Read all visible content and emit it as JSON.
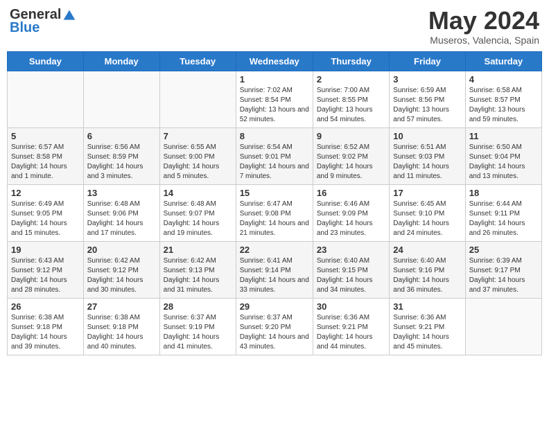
{
  "header": {
    "logo_general": "General",
    "logo_blue": "Blue",
    "month_title": "May 2024",
    "location": "Museros, Valencia, Spain"
  },
  "weekdays": [
    "Sunday",
    "Monday",
    "Tuesday",
    "Wednesday",
    "Thursday",
    "Friday",
    "Saturday"
  ],
  "weeks": [
    [
      {
        "day": "",
        "info": ""
      },
      {
        "day": "",
        "info": ""
      },
      {
        "day": "",
        "info": ""
      },
      {
        "day": "1",
        "info": "Sunrise: 7:02 AM\nSunset: 8:54 PM\nDaylight: 13 hours and 52 minutes."
      },
      {
        "day": "2",
        "info": "Sunrise: 7:00 AM\nSunset: 8:55 PM\nDaylight: 13 hours and 54 minutes."
      },
      {
        "day": "3",
        "info": "Sunrise: 6:59 AM\nSunset: 8:56 PM\nDaylight: 13 hours and 57 minutes."
      },
      {
        "day": "4",
        "info": "Sunrise: 6:58 AM\nSunset: 8:57 PM\nDaylight: 13 hours and 59 minutes."
      }
    ],
    [
      {
        "day": "5",
        "info": "Sunrise: 6:57 AM\nSunset: 8:58 PM\nDaylight: 14 hours and 1 minute."
      },
      {
        "day": "6",
        "info": "Sunrise: 6:56 AM\nSunset: 8:59 PM\nDaylight: 14 hours and 3 minutes."
      },
      {
        "day": "7",
        "info": "Sunrise: 6:55 AM\nSunset: 9:00 PM\nDaylight: 14 hours and 5 minutes."
      },
      {
        "day": "8",
        "info": "Sunrise: 6:54 AM\nSunset: 9:01 PM\nDaylight: 14 hours and 7 minutes."
      },
      {
        "day": "9",
        "info": "Sunrise: 6:52 AM\nSunset: 9:02 PM\nDaylight: 14 hours and 9 minutes."
      },
      {
        "day": "10",
        "info": "Sunrise: 6:51 AM\nSunset: 9:03 PM\nDaylight: 14 hours and 11 minutes."
      },
      {
        "day": "11",
        "info": "Sunrise: 6:50 AM\nSunset: 9:04 PM\nDaylight: 14 hours and 13 minutes."
      }
    ],
    [
      {
        "day": "12",
        "info": "Sunrise: 6:49 AM\nSunset: 9:05 PM\nDaylight: 14 hours and 15 minutes."
      },
      {
        "day": "13",
        "info": "Sunrise: 6:48 AM\nSunset: 9:06 PM\nDaylight: 14 hours and 17 minutes."
      },
      {
        "day": "14",
        "info": "Sunrise: 6:48 AM\nSunset: 9:07 PM\nDaylight: 14 hours and 19 minutes."
      },
      {
        "day": "15",
        "info": "Sunrise: 6:47 AM\nSunset: 9:08 PM\nDaylight: 14 hours and 21 minutes."
      },
      {
        "day": "16",
        "info": "Sunrise: 6:46 AM\nSunset: 9:09 PM\nDaylight: 14 hours and 23 minutes."
      },
      {
        "day": "17",
        "info": "Sunrise: 6:45 AM\nSunset: 9:10 PM\nDaylight: 14 hours and 24 minutes."
      },
      {
        "day": "18",
        "info": "Sunrise: 6:44 AM\nSunset: 9:11 PM\nDaylight: 14 hours and 26 minutes."
      }
    ],
    [
      {
        "day": "19",
        "info": "Sunrise: 6:43 AM\nSunset: 9:12 PM\nDaylight: 14 hours and 28 minutes."
      },
      {
        "day": "20",
        "info": "Sunrise: 6:42 AM\nSunset: 9:12 PM\nDaylight: 14 hours and 30 minutes."
      },
      {
        "day": "21",
        "info": "Sunrise: 6:42 AM\nSunset: 9:13 PM\nDaylight: 14 hours and 31 minutes."
      },
      {
        "day": "22",
        "info": "Sunrise: 6:41 AM\nSunset: 9:14 PM\nDaylight: 14 hours and 33 minutes."
      },
      {
        "day": "23",
        "info": "Sunrise: 6:40 AM\nSunset: 9:15 PM\nDaylight: 14 hours and 34 minutes."
      },
      {
        "day": "24",
        "info": "Sunrise: 6:40 AM\nSunset: 9:16 PM\nDaylight: 14 hours and 36 minutes."
      },
      {
        "day": "25",
        "info": "Sunrise: 6:39 AM\nSunset: 9:17 PM\nDaylight: 14 hours and 37 minutes."
      }
    ],
    [
      {
        "day": "26",
        "info": "Sunrise: 6:38 AM\nSunset: 9:18 PM\nDaylight: 14 hours and 39 minutes."
      },
      {
        "day": "27",
        "info": "Sunrise: 6:38 AM\nSunset: 9:18 PM\nDaylight: 14 hours and 40 minutes."
      },
      {
        "day": "28",
        "info": "Sunrise: 6:37 AM\nSunset: 9:19 PM\nDaylight: 14 hours and 41 minutes."
      },
      {
        "day": "29",
        "info": "Sunrise: 6:37 AM\nSunset: 9:20 PM\nDaylight: 14 hours and 43 minutes."
      },
      {
        "day": "30",
        "info": "Sunrise: 6:36 AM\nSunset: 9:21 PM\nDaylight: 14 hours and 44 minutes."
      },
      {
        "day": "31",
        "info": "Sunrise: 6:36 AM\nSunset: 9:21 PM\nDaylight: 14 hours and 45 minutes."
      },
      {
        "day": "",
        "info": ""
      }
    ]
  ]
}
